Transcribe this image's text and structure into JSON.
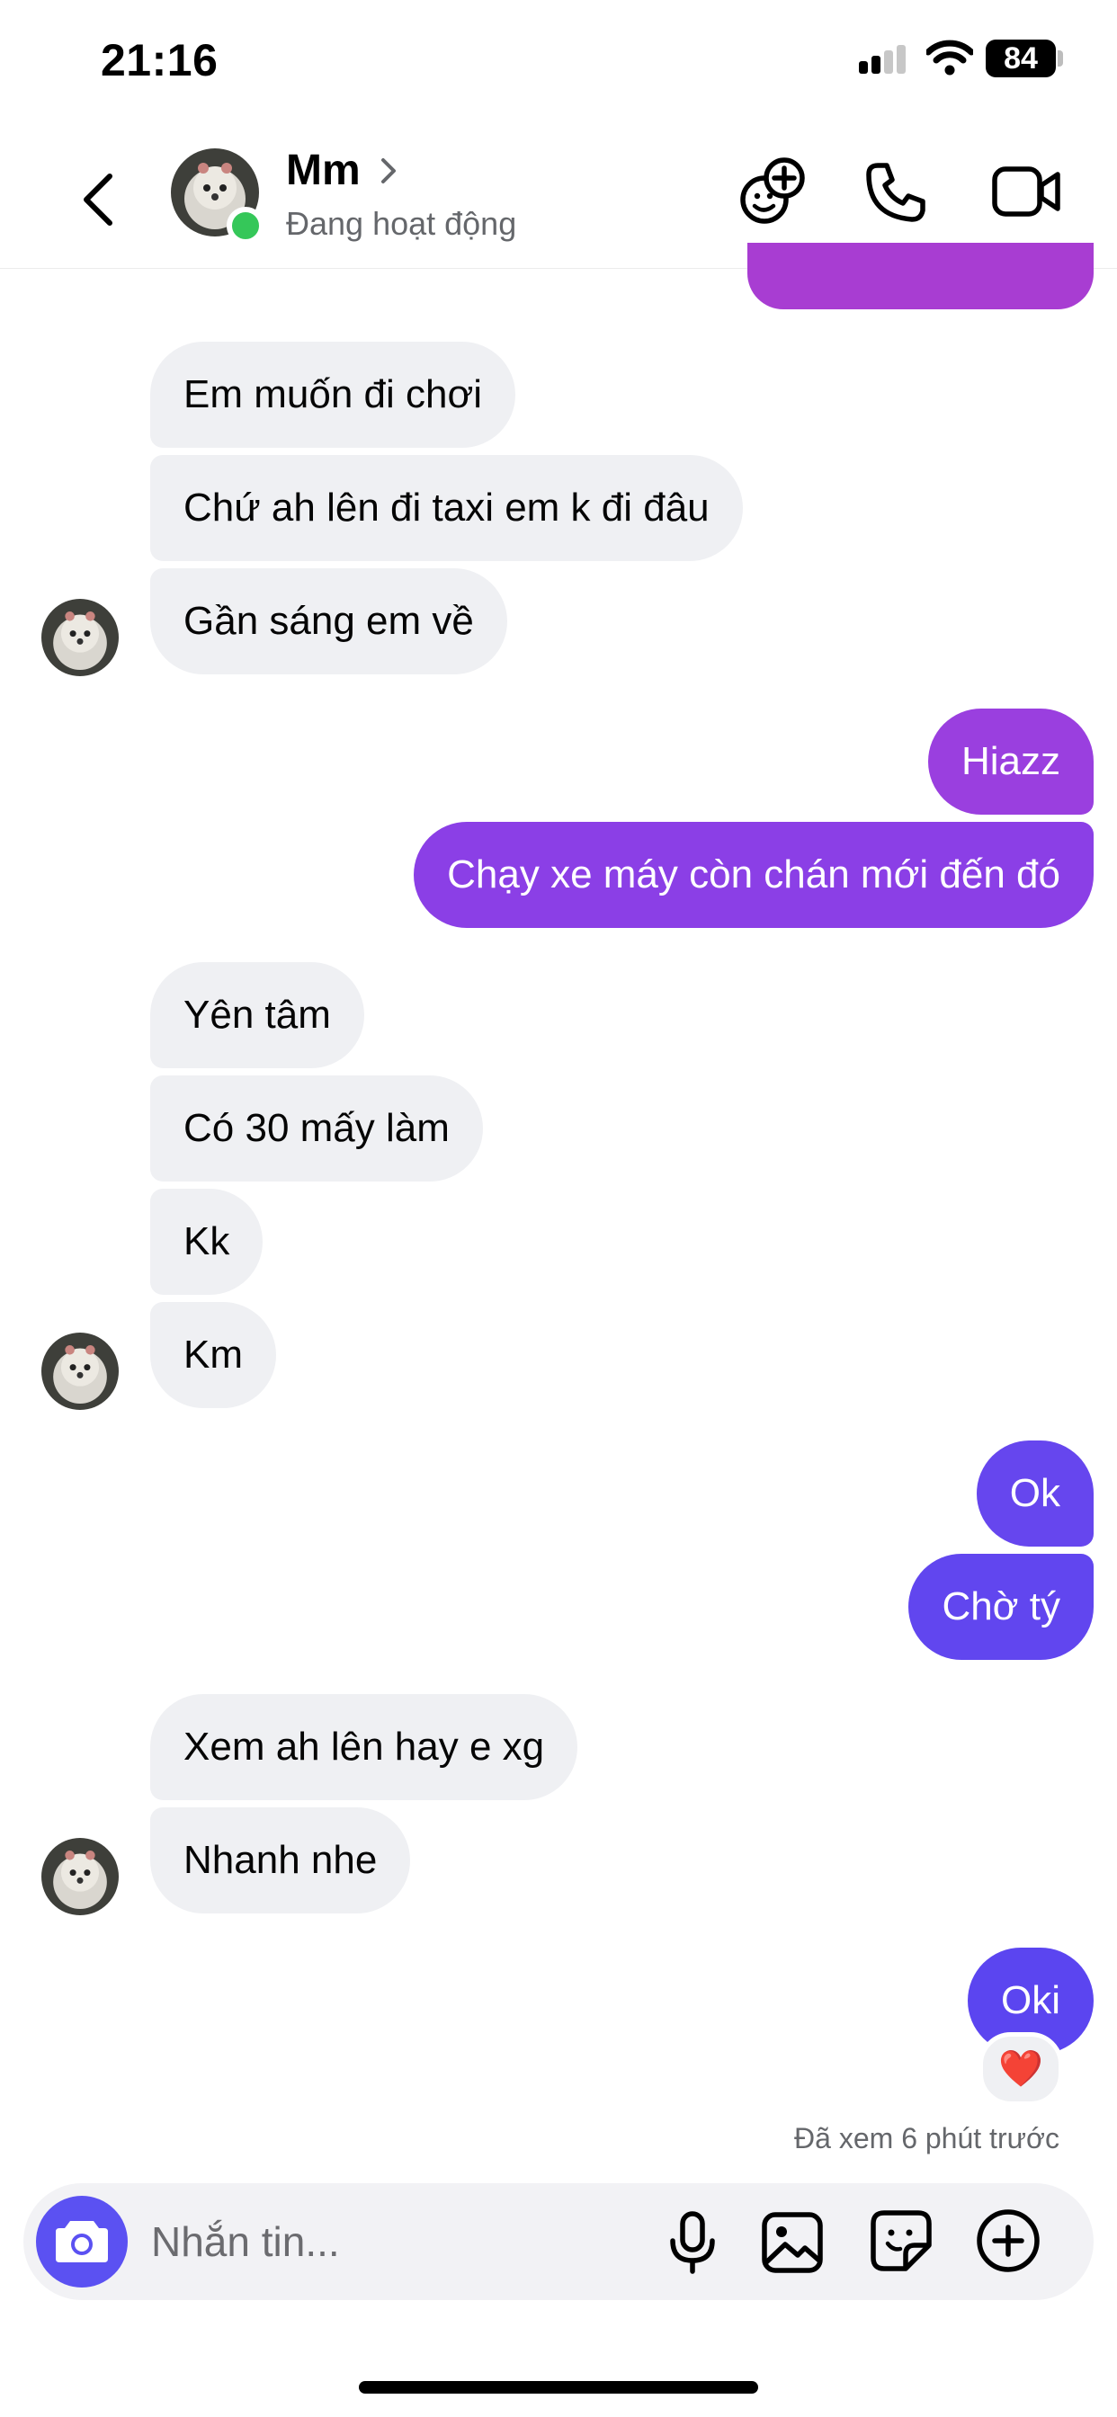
{
  "status_bar": {
    "time": "21:16",
    "battery": "84"
  },
  "header": {
    "name": "Mm",
    "status": "Đang hoạt động"
  },
  "messages": [
    {
      "side": "in",
      "text": "Em muốn đi chơi"
    },
    {
      "side": "in",
      "text": "Chứ ah lên đi taxi em k đi đâu"
    },
    {
      "side": "in",
      "text": "Gần sáng em về"
    },
    {
      "side": "out",
      "text": "Hiazz"
    },
    {
      "side": "out",
      "text": "Chạy xe máy còn chán mới đến đó"
    },
    {
      "side": "in",
      "text": "Yên tâm"
    },
    {
      "side": "in",
      "text": "Có 30 mấy làm"
    },
    {
      "side": "in",
      "text": "Kk"
    },
    {
      "side": "in",
      "text": "Km"
    },
    {
      "side": "out",
      "text": "Ok"
    },
    {
      "side": "out",
      "text": "Chờ tý"
    },
    {
      "side": "in",
      "text": "Xem ah lên hay e xg"
    },
    {
      "side": "in",
      "text": "Nhanh nhe"
    },
    {
      "side": "out",
      "text": "Oki"
    }
  ],
  "reaction": "❤️",
  "seen_text": "Đã xem 6 phút trước",
  "composer": {
    "placeholder": "Nhắn tin..."
  },
  "colors": {
    "outgoing_top": "#a83dd2",
    "outgoing_mid": "#8b3fe6",
    "outgoing_bottom": "#5b45f0",
    "incoming": "#eff0f3",
    "accent": "#5b51f2",
    "online": "#35c759"
  },
  "icons": [
    "back-icon",
    "chevron-right-icon",
    "effects-icon",
    "phone-icon",
    "video-icon",
    "camera-icon",
    "mic-icon",
    "gallery-icon",
    "sticker-icon",
    "plus-icon"
  ]
}
